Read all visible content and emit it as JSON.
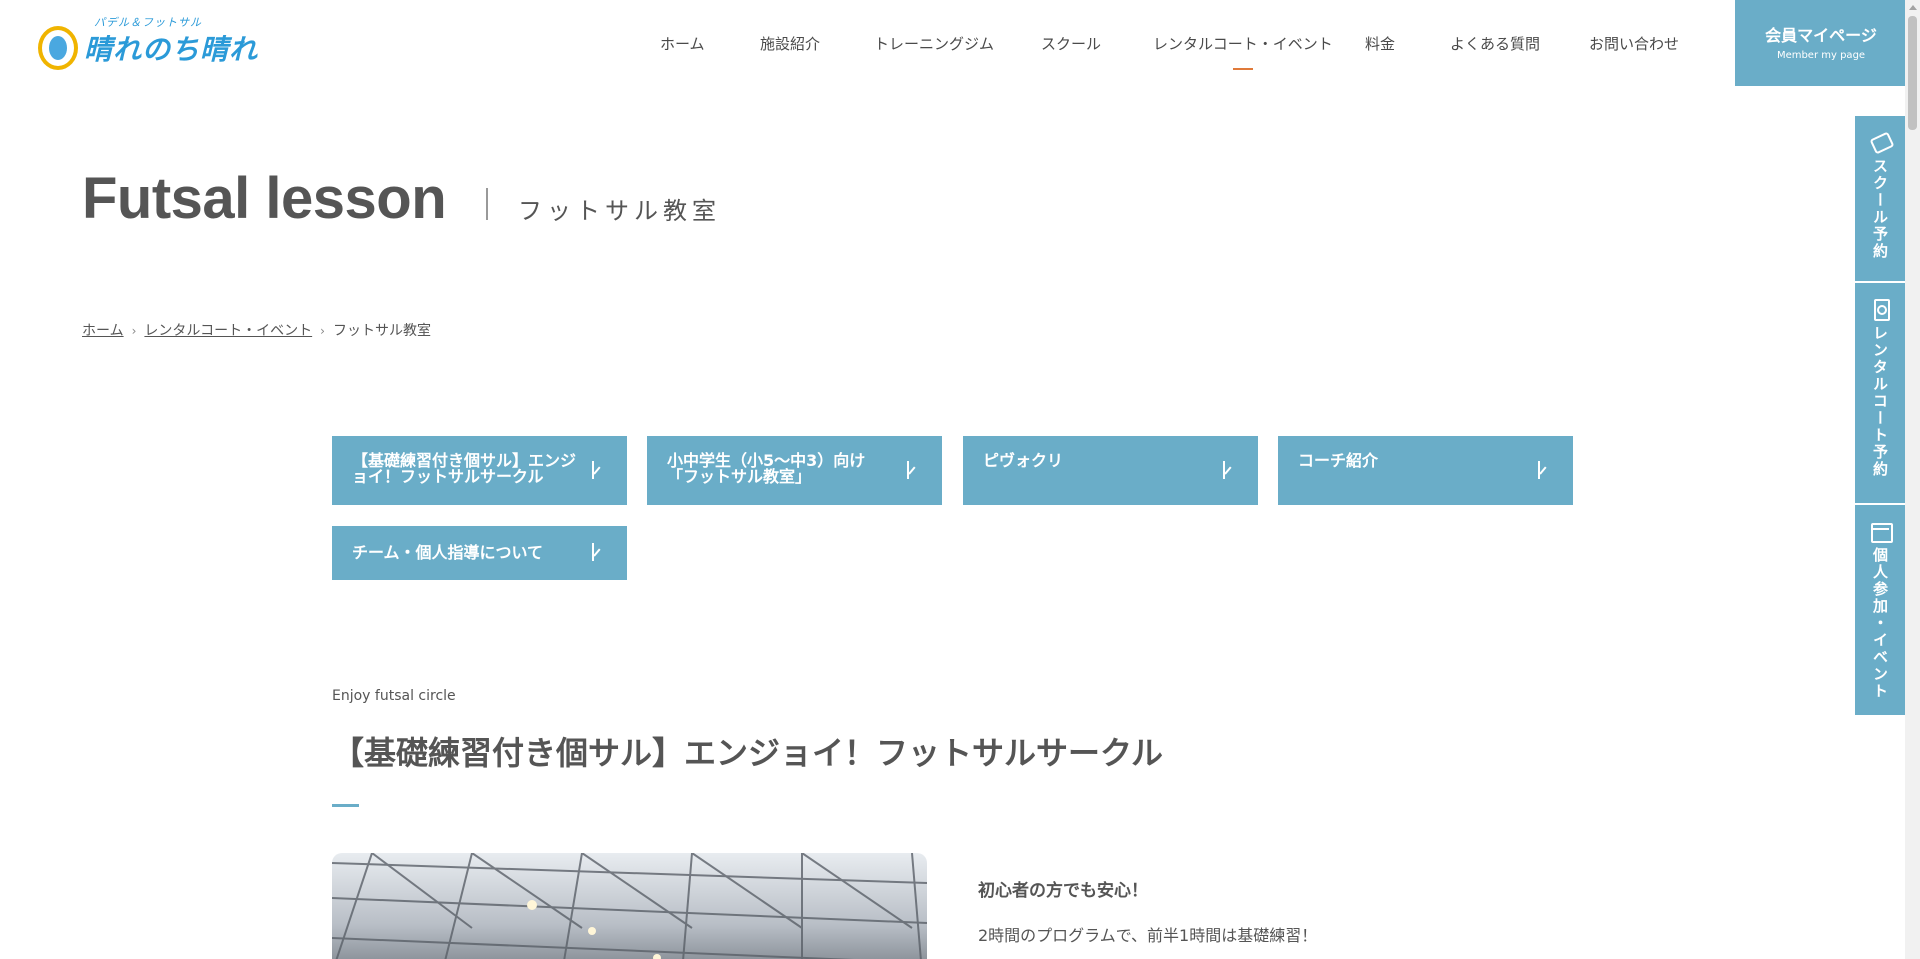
{
  "header": {
    "logo_sub": "パデル＆フットサル",
    "logo_main": "晴れのち晴れ",
    "nav": [
      {
        "label": "ホーム"
      },
      {
        "label": "施設紹介"
      },
      {
        "label": "トレーニングジム"
      },
      {
        "label": "スクール"
      },
      {
        "label": "レンタルコート・イベント",
        "active": true
      },
      {
        "label": "料金"
      },
      {
        "label": "よくある質問"
      },
      {
        "label": "お問い合わせ"
      }
    ],
    "member": {
      "label": "会員マイページ",
      "sub": "Member my page"
    }
  },
  "side_tabs": [
    {
      "label": "スクール予約",
      "icon": "ticket-icon"
    },
    {
      "label": "レンタルコート予約",
      "icon": "door-icon"
    },
    {
      "label": "個人参加・イベント",
      "icon": "calendar-icon"
    }
  ],
  "page": {
    "title": "Futsal lesson",
    "subtitle": "フットサル教室"
  },
  "breadcrumb": {
    "items": [
      "ホーム",
      "レンタルコート・イベント",
      "フットサル教室"
    ]
  },
  "anchors": [
    {
      "label": "【基礎練習付き個サル】エンジョイ！フットサルサークル"
    },
    {
      "label": "小中学生（小5～中3）向け「フットサル教室」"
    },
    {
      "label": "ピヴォクリ"
    },
    {
      "label": "コーチ紹介"
    },
    {
      "label": "チーム・個人指導について"
    }
  ],
  "section": {
    "en": "Enjoy futsal circle",
    "title": "【基礎練習付き個サル】エンジョイ！フットサルサークル",
    "lead": "初心者の方でも安心！",
    "text": "2時間のプログラムで、前半1時間は基礎練習！"
  },
  "colors": {
    "accent": "#6aadc8",
    "nav_active": "#e07a3a",
    "text": "#555555"
  }
}
